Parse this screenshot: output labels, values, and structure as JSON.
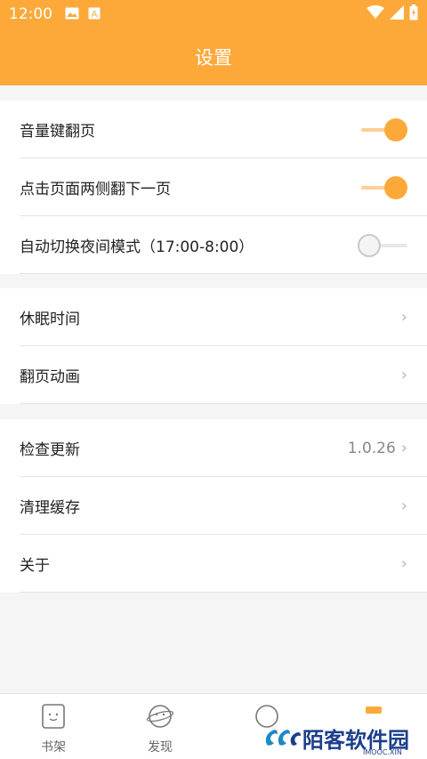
{
  "status_bar": {
    "time": "12:00",
    "left_icons": [
      "image-icon",
      "a-box-icon"
    ],
    "right_icons": [
      "wifi-icon",
      "signal-icon",
      "battery-icon"
    ]
  },
  "header": {
    "title": "设置"
  },
  "groups": [
    {
      "rows": [
        {
          "label": "音量键翻页",
          "control": "toggle",
          "state": "on"
        },
        {
          "label": "点击页面两侧翻下一页",
          "control": "toggle",
          "state": "on"
        },
        {
          "label": "自动切换夜间模式（17:00-8:00）",
          "control": "toggle",
          "state": "off"
        }
      ]
    },
    {
      "rows": [
        {
          "label": "休眠时间",
          "control": "chevron"
        },
        {
          "label": "翻页动画",
          "control": "chevron"
        }
      ]
    },
    {
      "rows": [
        {
          "label": "检查更新",
          "control": "chevron",
          "value": "1.0.26"
        },
        {
          "label": "清理缓存",
          "control": "chevron"
        },
        {
          "label": "关于",
          "control": "chevron"
        }
      ]
    }
  ],
  "chevron_glyph": "›",
  "tabbar": {
    "tabs": [
      {
        "label": "书架",
        "icon": "bookshelf-icon"
      },
      {
        "label": "发现",
        "icon": "discover-icon"
      },
      {
        "label": "",
        "icon": "profile-icon"
      },
      {
        "label": "",
        "icon": "settings-icon"
      }
    ]
  },
  "watermark": {
    "text": "陌客软件园",
    "sub": "IMOOC.XIN"
  },
  "colors": {
    "accent": "#fda93a",
    "background": "#f5f5f5"
  }
}
